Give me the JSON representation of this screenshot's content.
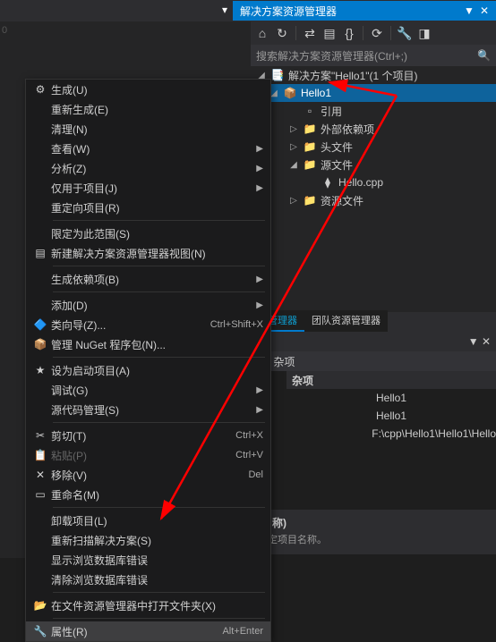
{
  "header": {
    "title": "解决方案资源管理器",
    "titlebar_icons": [
      "▼",
      "✕"
    ]
  },
  "toolbar": {
    "icons": [
      "home",
      "refresh-nav",
      "sync",
      "doc-lines",
      "brackets",
      "history",
      "wrench",
      "split"
    ]
  },
  "search": {
    "placeholder": "搜索解决方案资源管理器(Ctrl+;)"
  },
  "tree": {
    "solution": {
      "label": "解决方案\"Hello1\"(1 个项目)"
    },
    "project": {
      "label": "Hello1"
    },
    "children": [
      {
        "label": "引用",
        "indent": 2,
        "icon": "ref"
      },
      {
        "label": "外部依赖项",
        "indent": 2,
        "icon": "folder",
        "expandable": true
      },
      {
        "label": "头文件",
        "indent": 2,
        "icon": "folder",
        "expandable": true
      },
      {
        "label": "源文件",
        "indent": 2,
        "icon": "folder",
        "expanded": true,
        "expandable": true
      },
      {
        "label": "Hello.cpp",
        "indent": 3,
        "icon": "cpp"
      },
      {
        "label": "资源文件",
        "indent": 2,
        "icon": "folder",
        "expandable": true
      }
    ]
  },
  "tabs": [
    {
      "label": "源管理器",
      "active": true
    },
    {
      "label": "团队资源管理器",
      "active": false
    }
  ],
  "prop_category": "杂项",
  "properties": [
    {
      "label": "",
      "value": "Hello1"
    },
    {
      "label": "",
      "value": "Hello1"
    },
    {
      "label": "",
      "value": "F:\\cpp\\Hello1\\Hello1\\Hello"
    }
  ],
  "prop_desc": {
    "title": "(名称)",
    "body": "指定项目名称。"
  },
  "left_num": "0",
  "ctx": [
    {
      "type": "item",
      "icon": "build",
      "label": "生成(U)"
    },
    {
      "type": "item",
      "icon": "",
      "label": "重新生成(E)"
    },
    {
      "type": "item",
      "icon": "",
      "label": "清理(N)"
    },
    {
      "type": "item",
      "icon": "",
      "label": "查看(W)",
      "submenu": true
    },
    {
      "type": "item",
      "icon": "",
      "label": "分析(Z)",
      "submenu": true
    },
    {
      "type": "item",
      "icon": "",
      "label": "仅用于项目(J)",
      "submenu": true
    },
    {
      "type": "item",
      "icon": "",
      "label": "重定向项目(R)"
    },
    {
      "type": "sep"
    },
    {
      "type": "item",
      "icon": "",
      "label": "限定为此范围(S)"
    },
    {
      "type": "item",
      "icon": "new-view",
      "label": "新建解决方案资源管理器视图(N)"
    },
    {
      "type": "sep"
    },
    {
      "type": "item",
      "icon": "",
      "label": "生成依赖项(B)",
      "submenu": true
    },
    {
      "type": "sep"
    },
    {
      "type": "item",
      "icon": "",
      "label": "添加(D)",
      "submenu": true
    },
    {
      "type": "item",
      "icon": "class-wizard",
      "label": "类向导(Z)...",
      "shortcut": "Ctrl+Shift+X"
    },
    {
      "type": "item",
      "icon": "nuget",
      "label": "管理 NuGet 程序包(N)..."
    },
    {
      "type": "sep"
    },
    {
      "type": "item",
      "icon": "star",
      "label": "设为启动项目(A)"
    },
    {
      "type": "item",
      "icon": "",
      "label": "调试(G)",
      "submenu": true
    },
    {
      "type": "item",
      "icon": "",
      "label": "源代码管理(S)",
      "submenu": true
    },
    {
      "type": "sep"
    },
    {
      "type": "item",
      "icon": "cut",
      "label": "剪切(T)",
      "shortcut": "Ctrl+X"
    },
    {
      "type": "item",
      "icon": "paste",
      "label": "粘贴(P)",
      "shortcut": "Ctrl+V",
      "disabled": true
    },
    {
      "type": "item",
      "icon": "delete",
      "label": "移除(V)",
      "shortcut": "Del"
    },
    {
      "type": "item",
      "icon": "rename",
      "label": "重命名(M)"
    },
    {
      "type": "sep"
    },
    {
      "type": "item",
      "icon": "",
      "label": "卸载项目(L)"
    },
    {
      "type": "item",
      "icon": "",
      "label": "重新扫描解决方案(S)"
    },
    {
      "type": "item",
      "icon": "",
      "label": "显示浏览数据库错误"
    },
    {
      "type": "item",
      "icon": "",
      "label": "清除浏览数据库错误"
    },
    {
      "type": "sep"
    },
    {
      "type": "item",
      "icon": "folder-open",
      "label": "在文件资源管理器中打开文件夹(X)"
    },
    {
      "type": "sep"
    },
    {
      "type": "item",
      "icon": "wrench",
      "label": "属性(R)",
      "shortcut": "Alt+Enter",
      "hover": true
    }
  ]
}
